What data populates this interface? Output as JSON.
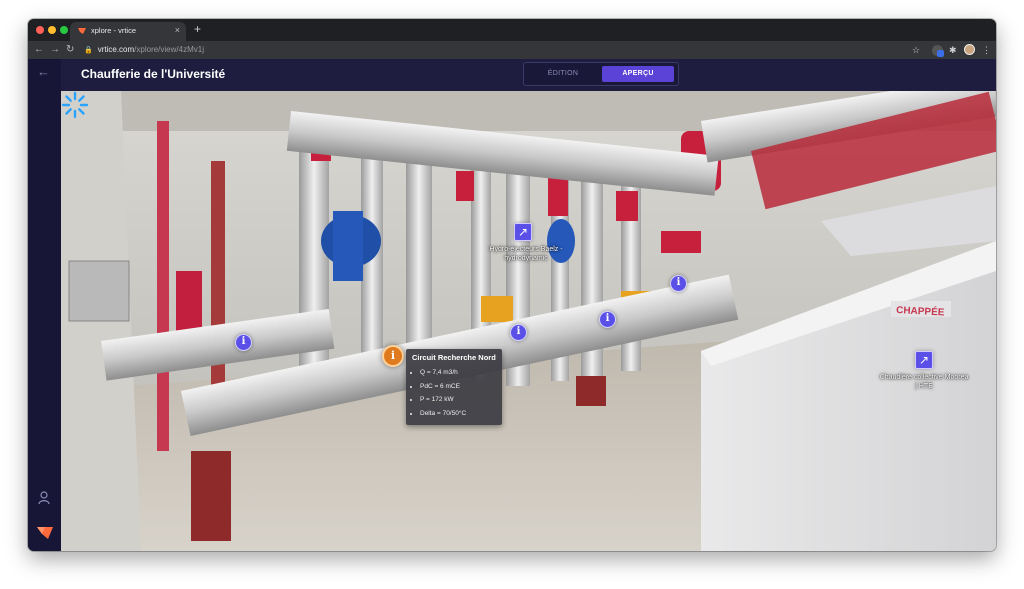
{
  "browser": {
    "tab_title": "xplore - vrtice",
    "url_host": "vrtice.com",
    "url_path": "/xplore/view/4zMv1j",
    "new_tab": "+",
    "tab_close": "×"
  },
  "app": {
    "title": "Chaufferie de l'Université",
    "modes": {
      "edit": "ÉDITION",
      "preview": "APERÇU",
      "selected": "preview"
    }
  },
  "scene": {
    "link_hotspots": [
      {
        "label": "Hydro-éjecteurs Baelz -\nhydrodynamic"
      },
      {
        "label": "Chaudière collective Moorea\n| HTE"
      }
    ],
    "info_popup": {
      "title": "Circuit Recherche Nord",
      "items": [
        "Q = 7,4 m3/h",
        "PdC = 6 mCE",
        "P = 172 kW",
        "Delta = 70/50°C"
      ]
    }
  },
  "colors": {
    "accent": "#5a43d6",
    "hotspot": "#5a4fe6",
    "active_hotspot": "#e07a1f",
    "header_bg": "#1e1d40"
  }
}
